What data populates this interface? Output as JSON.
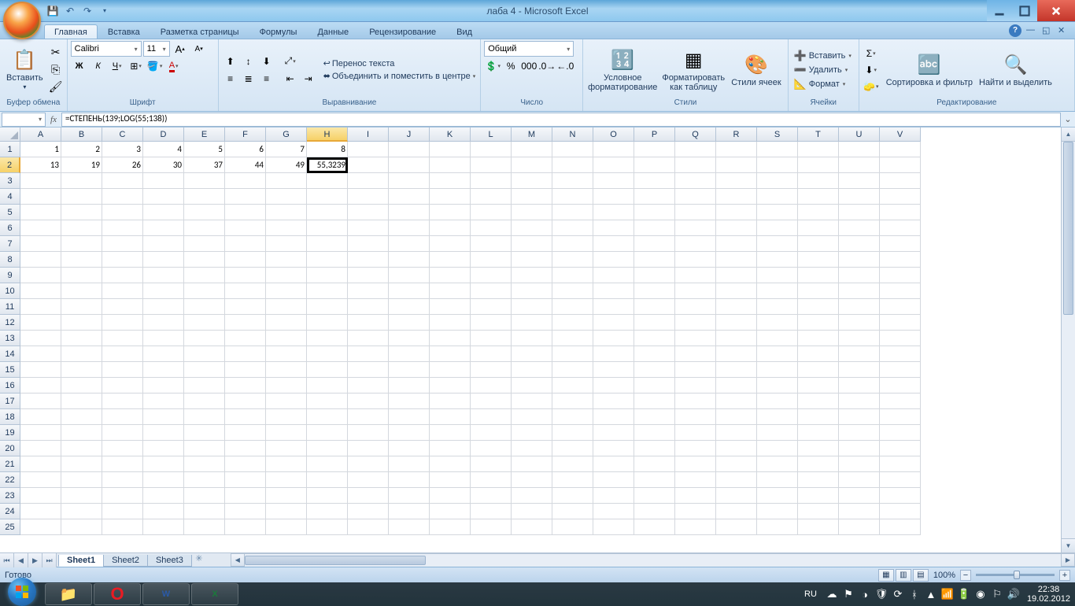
{
  "app": {
    "title": "лаба 4 - Microsoft Excel"
  },
  "tabs": [
    "Главная",
    "Вставка",
    "Разметка страницы",
    "Формулы",
    "Данные",
    "Рецензирование",
    "Вид"
  ],
  "activeTab": 0,
  "ribbon": {
    "clipboard": {
      "paste": "Вставить",
      "label": "Буфер обмена"
    },
    "font": {
      "name": "Calibri",
      "size": "11",
      "label": "Шрифт"
    },
    "alignment": {
      "wrap": "Перенос текста",
      "merge": "Объединить и поместить в центре",
      "label": "Выравнивание"
    },
    "number": {
      "format": "Общий",
      "label": "Число"
    },
    "styles": {
      "cond": "Условное форматирование",
      "table": "Форматировать как таблицу",
      "cell": "Стили ячеек",
      "label": "Стили"
    },
    "cells": {
      "insert": "Вставить",
      "delete": "Удалить",
      "format": "Формат",
      "label": "Ячейки"
    },
    "editing": {
      "sort": "Сортировка и фильтр",
      "find": "Найти и выделить",
      "label": "Редактирование"
    }
  },
  "formulaBar": {
    "nameBox": "",
    "formula": "=СТЕПЕНЬ(139;LOG(55;138))"
  },
  "grid": {
    "columns": [
      "A",
      "B",
      "C",
      "D",
      "E",
      "F",
      "G",
      "H",
      "I",
      "J",
      "K",
      "L",
      "M",
      "N",
      "O",
      "P",
      "Q",
      "R",
      "S",
      "T",
      "U",
      "V"
    ],
    "rowCount": 25,
    "activeCell": {
      "row": 2,
      "col": 8
    },
    "data": {
      "1": [
        "1",
        "2",
        "3",
        "4",
        "5",
        "6",
        "7",
        "8"
      ],
      "2": [
        "13",
        "19",
        "26",
        "30",
        "37",
        "44",
        "49",
        "55,3239"
      ]
    }
  },
  "sheets": {
    "items": [
      "Sheet1",
      "Sheet2",
      "Sheet3"
    ],
    "active": 0
  },
  "statusBar": {
    "status": "Готово",
    "zoom": "100%"
  },
  "taskbar": {
    "lang": "RU",
    "time": "22:38",
    "date": "19.02.2012"
  }
}
